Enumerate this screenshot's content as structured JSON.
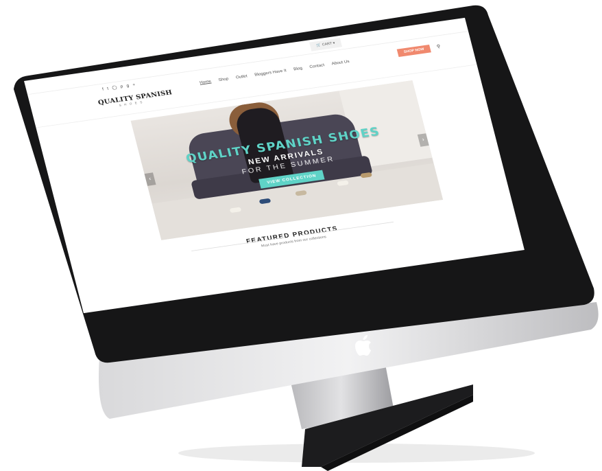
{
  "topbar": {
    "cart_label": "CART"
  },
  "header": {
    "social_icons": [
      "facebook-icon",
      "twitter-icon",
      "instagram-icon",
      "pinterest-icon",
      "google-plus-icon"
    ],
    "logo_text": "QUALITY SPANISH",
    "logo_sub": "SHOES",
    "nav": [
      "Home",
      "Shop",
      "Outlet",
      "Bloggers Have It",
      "Blog",
      "Contact",
      "About Us"
    ],
    "shop_now": "SHOP NOW",
    "search_icon": "search-icon"
  },
  "hero": {
    "title": "QUALITY SPANISH SHOES",
    "subtitle": "NEW ARRIVALS",
    "subtitle2": "FOR THE SUMMER",
    "button": "VIEW COLLECTION",
    "accent": "#5fd3c7"
  },
  "featured": {
    "title": "FEATURED PRODUCTS",
    "subtitle": "Must have products from our collections"
  },
  "colors": {
    "shop_button": "#f0896e",
    "bezel": "#1a1a1a",
    "frame": "#c8c8ca"
  }
}
